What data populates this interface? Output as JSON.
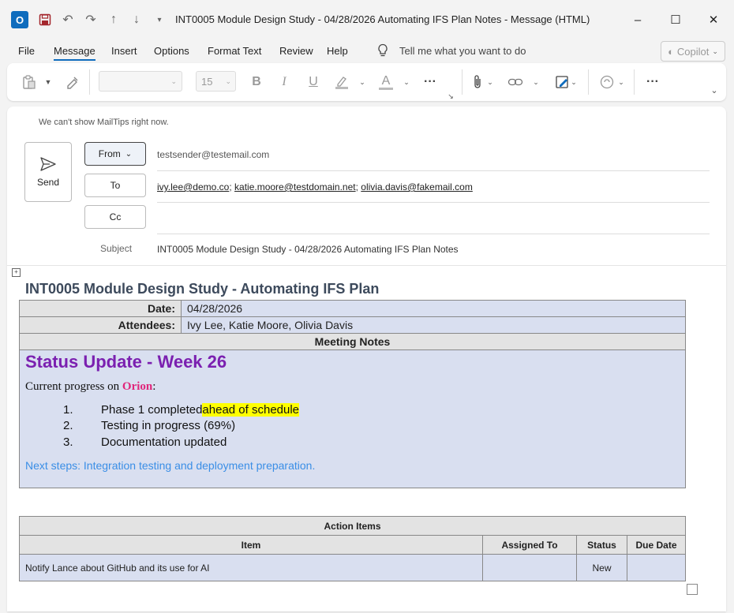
{
  "window": {
    "title": "INT0005 Module Design Study - 04/28/2026 Automating IFS Plan Notes  -  Message (HTML)",
    "app_icon": "outlook-icon",
    "save_icon": "save-icon",
    "undo_icon": "undo-icon",
    "redo_icon": "redo-icon",
    "up_icon": "arrow-up-icon",
    "down_icon": "arrow-down-icon",
    "customize_icon": "customize-icon",
    "minimize": "–",
    "maximize": "☐",
    "close": "✕"
  },
  "menu": {
    "items": [
      "File",
      "Message",
      "Insert",
      "Options",
      "Format Text",
      "Review",
      "Help"
    ],
    "active": "Message",
    "tell_me": "Tell me what you want to do",
    "copilot": "Copilot"
  },
  "ribbon": {
    "font_name": "",
    "font_size": "15",
    "bold": "B",
    "italic": "I",
    "underline": "U",
    "font_color_glyph": "A",
    "more": "···"
  },
  "compose": {
    "mailtips": "We can't show MailTips right now.",
    "send_label": "Send",
    "from_label": "From",
    "to_label": "To",
    "cc_label": "Cc",
    "subject_label": "Subject",
    "from_value": "testsender@testemail.com",
    "to_recipients": [
      "ivy.lee@demo.co",
      "katie.moore@testdomain.net",
      "olivia.davis@fakemail.com"
    ],
    "cc_value": "",
    "subject_value": "INT0005 Module Design Study - 04/28/2026 Automating IFS Plan Notes"
  },
  "body": {
    "title": "INT0005 Module Design Study - Automating IFS Plan",
    "meeting_table": {
      "date_label": "Date:",
      "date_value": "04/28/2026",
      "attendees_label": "Attendees:",
      "attendees_value": "Ivy Lee, Katie Moore, Olivia Davis",
      "notes_header": "Meeting Notes"
    },
    "notes": {
      "heading": "Status Update - Week 26",
      "progress_prefix": "Current progress on ",
      "project": "Orion",
      "progress_suffix": ":",
      "items": [
        {
          "num": "1.",
          "text": "Phase 1 completed ",
          "highlight": "ahead of schedule"
        },
        {
          "num": "2.",
          "text": "Testing in progress (69%)",
          "highlight": ""
        },
        {
          "num": "3.",
          "text": "Documentation updated",
          "highlight": ""
        }
      ],
      "next_steps": "Next steps: Integration testing and deployment preparation."
    },
    "action_items": {
      "header": "Action Items",
      "columns": [
        "Item",
        "Assigned To",
        "Status",
        "Due Date"
      ],
      "rows": [
        {
          "item": "Notify Lance about GitHub and its use for AI",
          "assigned_to": "",
          "status": "New",
          "due_date": ""
        }
      ]
    }
  },
  "colors": {
    "accent": "#0f6cbd",
    "status_heading": "#7b20b0",
    "project_name": "#e0257a",
    "next_steps": "#3a8ee6",
    "table_fill": "#d9dff0",
    "table_header": "#e3e3e3",
    "highlight": "#ffff00"
  }
}
